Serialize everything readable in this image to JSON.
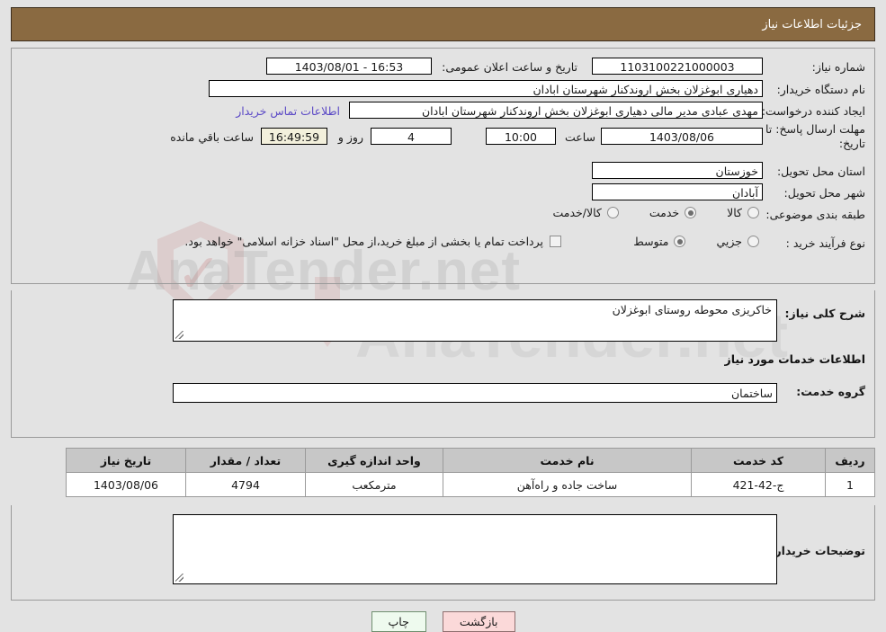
{
  "header": {
    "title": "جزئیات اطلاعات نیاز",
    "bg_color": "#8a6a41"
  },
  "watermark": {
    "brand": "AnaTender",
    "suffix": ".net",
    "domain_text": "AnaTender.net"
  },
  "need_info": {
    "need_number_label": "شماره نیاز:",
    "need_number_value": "1103100221000003",
    "public_announce_label": "تاریخ و ساعت اعلان عمومی:",
    "public_announce_value": "16:53 - 1403/08/01",
    "buyer_org_label": "نام دستگاه خریدار:",
    "buyer_org_value": "دهیاری ابوغزلان بخش اروندکنار شهرستان ابادان",
    "requester_label": "ایجاد کننده درخواست:",
    "requester_value": "مهدی عبادی مدیر مالی دهیاری ابوغزلان بخش اروندکنار شهرستان ابادان",
    "buyer_contact_link": "اطلاعات تماس خریدار",
    "deadline_label": "مهلت ارسال پاسخ: تا تاریخ:",
    "deadline_date": "1403/08/06",
    "deadline_hour_label": "ساعت",
    "deadline_time": "10:00",
    "remaining_days": "4",
    "days_and_label": "روز و",
    "remaining_clock": "16:49:59",
    "remaining_suffix": "ساعت باقي مانده",
    "province_label": "استان محل تحویل:",
    "province_value": "خوزستان",
    "city_label": "شهر محل تحویل:",
    "city_value": "آبادان",
    "category_label": "طبقه بندی موضوعی:",
    "category_options": [
      {
        "label": "کالا",
        "selected": false
      },
      {
        "label": "خدمت",
        "selected": true
      },
      {
        "label": "کالا/خدمت",
        "selected": false
      }
    ],
    "process_label": "نوع فرآیند خرید :",
    "process_options": [
      {
        "label": "جزیي",
        "selected": false
      },
      {
        "label": "متوسط",
        "selected": true
      }
    ],
    "treasury_checkbox_checked": false,
    "treasury_text": "پرداخت تمام یا بخشی از مبلغ خرید،از محل \"اسناد خزانه اسلامی\" خواهد بود."
  },
  "description": {
    "general_need_label": "شرح کلی نیاز:",
    "general_need_value": "خاکریزی محوطه روستای ابوغزلان",
    "services_section_title": "اطلاعات خدمات مورد نیاز",
    "service_group_label": "گروه خدمت:",
    "service_group_value": "ساختمان"
  },
  "table": {
    "columns": [
      "ردیف",
      "کد خدمت",
      "نام خدمت",
      "واحد اندازه گیری",
      "تعداد / مقدار",
      "تاریخ نیاز"
    ],
    "rows": [
      {
        "index": "1",
        "code": "ج-42-421",
        "name": "ساخت جاده و راه‌آهن",
        "unit": "مترمکعب",
        "quantity": "4794",
        "date": "1403/08/06"
      }
    ]
  },
  "buyer_notes": {
    "label": "توضیحات خریدار:",
    "value": ""
  },
  "actions": {
    "print_label": "چاپ",
    "back_label": "بازگشت"
  }
}
